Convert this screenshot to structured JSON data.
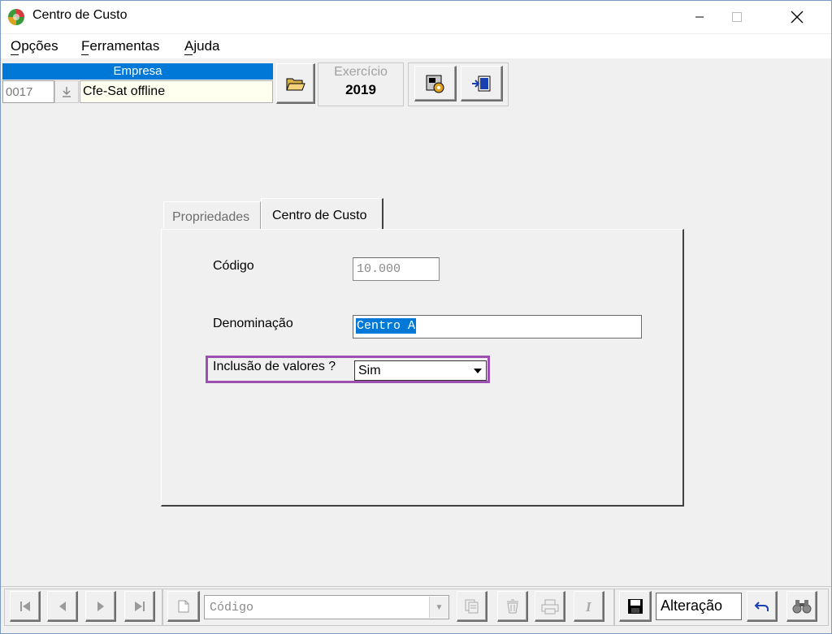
{
  "window": {
    "title": "Centro de Custo",
    "icon": "app-globe-icon"
  },
  "menu": {
    "items": [
      {
        "label": "Opções"
      },
      {
        "label": "Ferramentas"
      },
      {
        "label": "Ajuda"
      }
    ]
  },
  "toolbar": {
    "empresa_label": "Empresa",
    "empresa_code": "0017",
    "empresa_name": "Cfe-Sat offline",
    "exercicio_label": "Exercício",
    "exercicio_value": "2019"
  },
  "tabs": [
    {
      "label": "Propriedades",
      "active": false
    },
    {
      "label": "Centro de Custo",
      "active": true
    }
  ],
  "form": {
    "codigo_label": "Código",
    "codigo_value": "10.000",
    "denominacao_label": "Denominação",
    "denominacao_value": "Centro A",
    "inclusao_label": "Inclusão de valores ?",
    "inclusao_value": "Sim"
  },
  "bottombar": {
    "search_placeholder": "Código",
    "mode_text": "Alteração"
  },
  "colors": {
    "accent": "#0078d7",
    "highlight": "#9b4fb0",
    "empresa_bg": "#fffff0"
  }
}
